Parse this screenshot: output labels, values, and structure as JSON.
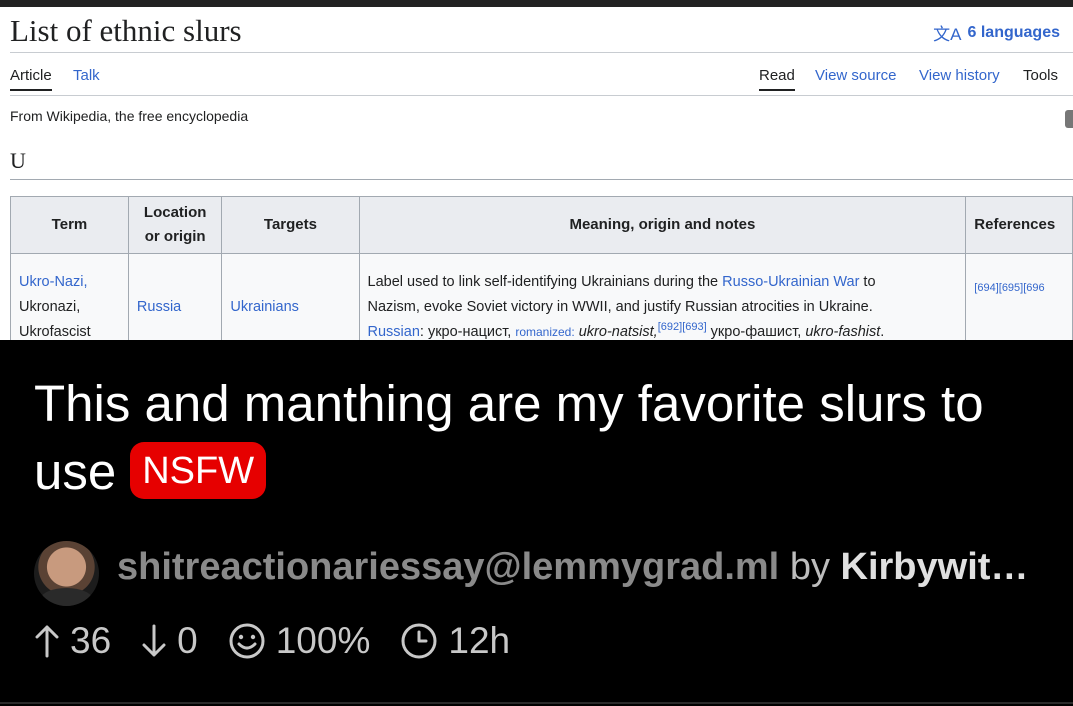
{
  "wiki": {
    "title": "List of ethnic slurs",
    "languages": "6 languages",
    "tabs": {
      "article": "Article",
      "talk": "Talk",
      "read": "Read",
      "view_source": "View source",
      "view_history": "View history",
      "tools": "Tools"
    },
    "tagline": "From Wikipedia, the free encyclopedia",
    "section": "U",
    "table": {
      "headers": {
        "term": "Term",
        "location_line1": "Location",
        "location_line2": "or origin",
        "targets": "Targets",
        "meaning": "Meaning, origin and notes",
        "references": "References"
      },
      "row": {
        "term1": "Ukro-Nazi,",
        "term2": "Ukronazi,",
        "term3": "Ukrofascist",
        "location": "Russia",
        "targets": "Ukrainians",
        "meaning_part1": "Label used to link self-identifying Ukrainians during the ",
        "meaning_link": "Russo-Ukrainian War",
        "meaning_part2": " to",
        "meaning_line2": "Nazism, evoke Soviet victory in WWII, and justify Russian atrocities in Ukraine.",
        "russian_label": "Russian",
        "russian_text1": ": укро-нацист, ",
        "romanized_label": "romanized:",
        "romanized1": "ukro-natsist,",
        "cite1": "[692]",
        "cite2": "[693]",
        "russian_text2": " укро-фашист, ",
        "romanized2": "ukro-fashist",
        "period": ".",
        "references": "[694][695][696"
      }
    }
  },
  "post": {
    "title": "This and manthing are my favorite slurs to use",
    "nsfw_badge": "NSFW",
    "community": "shitreactionariessay@lemmygrad.ml",
    "by_label": "by",
    "author": "Kirbywit…",
    "stats": {
      "upvotes": "36",
      "downvotes": "0",
      "ratio": "100%",
      "age": "12h"
    }
  },
  "icons": [
    "translate-icon",
    "lock-icon",
    "avatar",
    "upvote-icon",
    "downvote-icon",
    "smile-icon",
    "clock-icon"
  ],
  "colors": {
    "link": "#3366cc",
    "nsfw": "#e60000",
    "background": "#000000"
  }
}
